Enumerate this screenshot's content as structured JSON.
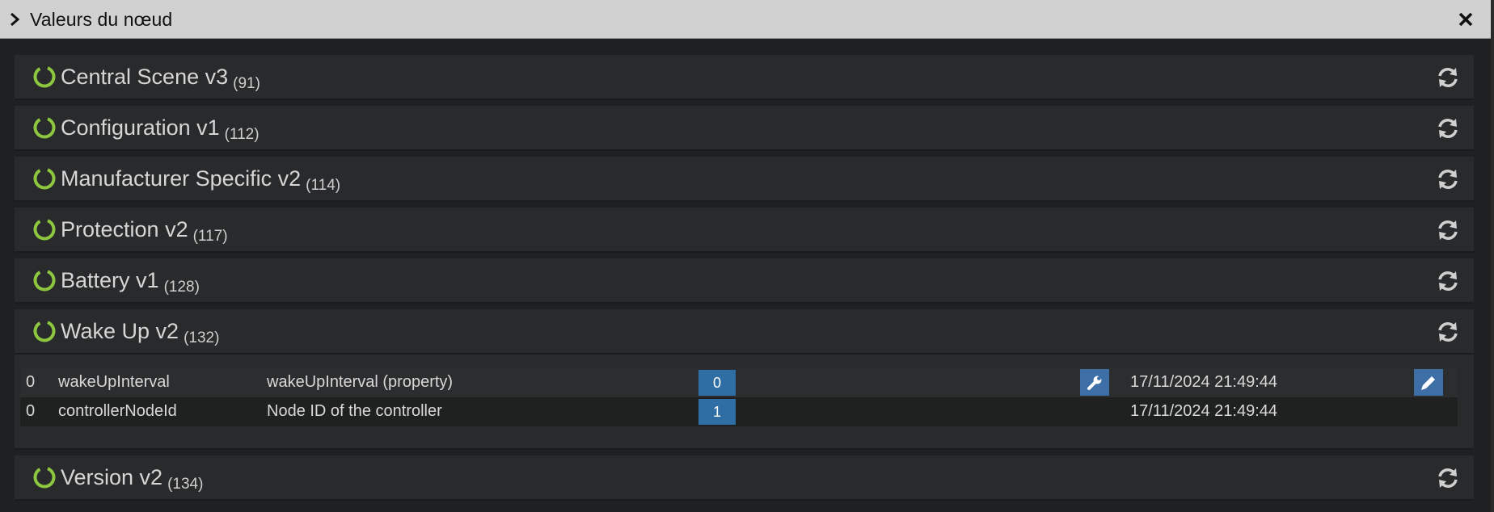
{
  "window": {
    "title": "Valeurs du nœud"
  },
  "accent_color": "#8dc63f",
  "panels": [
    {
      "name": "Central Scene v3",
      "id": "(91)"
    },
    {
      "name": "Configuration v1",
      "id": "(112)"
    },
    {
      "name": "Manufacturer Specific v2",
      "id": "(114)"
    },
    {
      "name": "Protection v2",
      "id": "(117)"
    },
    {
      "name": "Battery v1",
      "id": "(128)"
    },
    {
      "name": "Wake Up v2",
      "id": "(132)"
    },
    {
      "name": "Version v2",
      "id": "(134)"
    }
  ],
  "wake_up_values": [
    {
      "index": "0",
      "key": "wakeUpInterval",
      "label": "wakeUpInterval (property)",
      "value": "0",
      "date": "17/11/2024 21:49:44"
    },
    {
      "index": "0",
      "key": "controllerNodeId",
      "label": "Node ID of the controller",
      "value": "1",
      "date": "17/11/2024 21:49:44"
    }
  ],
  "icons": {
    "panel_status": "ring-icon",
    "panel_action": "refresh-icon",
    "row_settings": "wrench-icon",
    "row_edit": "pencil-icon",
    "window_toggle": "chevron-right-icon",
    "window_close": "close-icon"
  }
}
